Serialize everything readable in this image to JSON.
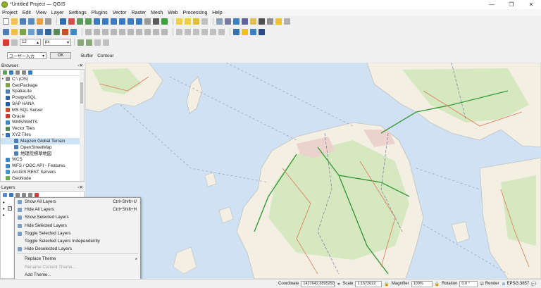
{
  "window": {
    "title": "*Untitled Project — QGIS",
    "min_label": "—",
    "restore_label": "❐",
    "close_label": "✕"
  },
  "menubar": [
    "Project",
    "Edit",
    "View",
    "Layer",
    "Settings",
    "Plugins",
    "Vector",
    "Raster",
    "Mesh",
    "Web",
    "Processing",
    "Help"
  ],
  "toolbar4": {
    "user_input": "ユーザー入力",
    "ok_button": "OK",
    "buffer": "Buffer",
    "contour": "Contour"
  },
  "toolbar3": {
    "size_value": "12",
    "unit": "px"
  },
  "browser": {
    "title": "Browser",
    "items": [
      {
        "label": "C:\\ (OS)",
        "icon": "drive-icon",
        "color": "#8a8a8a",
        "expand": "▸"
      },
      {
        "label": "GeoPackage",
        "icon": "geopackage-icon",
        "color": "#7aa34a",
        "expand": ""
      },
      {
        "label": "SpatiaLite",
        "icon": "spatialite-icon",
        "color": "#4d7fb8",
        "expand": ""
      },
      {
        "label": "PostgreSQL",
        "icon": "postgresql-icon",
        "color": "#336699",
        "expand": ""
      },
      {
        "label": "SAP HANA",
        "icon": "sap-hana-icon",
        "color": "#1f5ea8",
        "expand": ""
      },
      {
        "label": "MS SQL Server",
        "icon": "mssql-icon",
        "color": "#c8502c",
        "expand": ""
      },
      {
        "label": "Oracle",
        "icon": "oracle-icon",
        "color": "#d23b2b",
        "expand": ""
      },
      {
        "label": "WMS/WMTS",
        "icon": "wms-icon",
        "color": "#3f88c5",
        "expand": ""
      },
      {
        "label": "Vector Tiles",
        "icon": "vector-tiles-icon",
        "color": "#5a8a5a",
        "expand": ""
      },
      {
        "label": "XYZ Tiles",
        "icon": "xyz-tiles-icon",
        "color": "#2e6fb5",
        "expand": "▾"
      },
      {
        "label": "Mapzen Global Terrain",
        "icon": "tile-layer-icon",
        "color": "#4a7eb5",
        "expand": "",
        "indent": true,
        "selected": true
      },
      {
        "label": "OpenStreetMap",
        "icon": "tile-layer-icon",
        "color": "#4a7eb5",
        "expand": "",
        "indent": true
      },
      {
        "label": "地理院標準地図",
        "icon": "tile-layer-icon",
        "color": "#4a7eb5",
        "expand": "",
        "indent": true
      },
      {
        "label": "WCS",
        "icon": "wcs-icon",
        "color": "#3f88c5",
        "expand": ""
      },
      {
        "label": "WFS / OGC API - Features",
        "icon": "wfs-icon",
        "color": "#3f88c5",
        "expand": ""
      },
      {
        "label": "ArcGIS REST Servers",
        "icon": "arcgis-icon",
        "color": "#4a90c8",
        "expand": ""
      },
      {
        "label": "GeoNode",
        "icon": "geonode-icon",
        "color": "#6aa84f",
        "expand": ""
      }
    ]
  },
  "layers": {
    "title": "Layers"
  },
  "context_menu": {
    "items": [
      {
        "label": "Show All Layers",
        "shortcut": "Ctrl+Shift+U",
        "icon": true
      },
      {
        "label": "Hide All Layers",
        "shortcut": "Ctrl+Shift+H",
        "icon": true
      },
      {
        "label": "Show Selected Layers",
        "icon": true
      },
      {
        "label": "Hide Selected Layers",
        "icon": true
      },
      {
        "label": "Toggle Selected Layers",
        "icon": true
      },
      {
        "label": "Toggle Selected Layers Independently",
        "icon": false
      },
      {
        "label": "Hide Deselected Layers",
        "icon": true
      },
      {
        "label": "Replace Theme",
        "submenu": true
      },
      {
        "label": "Rename Current Theme...",
        "disabled": true
      },
      {
        "label": "Add Theme..."
      },
      {
        "label": "Remove Current Theme",
        "disabled": true
      }
    ]
  },
  "statusbar": {
    "search_placeholder": "Ty",
    "coordinate_label": "Coordinate",
    "coordinate_value": "1427642,3895250",
    "scale_label": "Scale",
    "scale_value": "1:1572022",
    "magnifier_label": "Magnifier",
    "magnifier_value": "100%",
    "rotation_label": "Rotation",
    "rotation_value": "0.0 °",
    "render_label": "Render",
    "crs": "EPSG:3857"
  },
  "colors": {
    "sea": "#cfe1f2",
    "land": "#f5f1e6",
    "forest": "#cfe6b8",
    "urban": "#e8c8c8",
    "highway": "#3a9a3a",
    "road": "#e07a5a",
    "boundary": "#8a8aa8"
  }
}
